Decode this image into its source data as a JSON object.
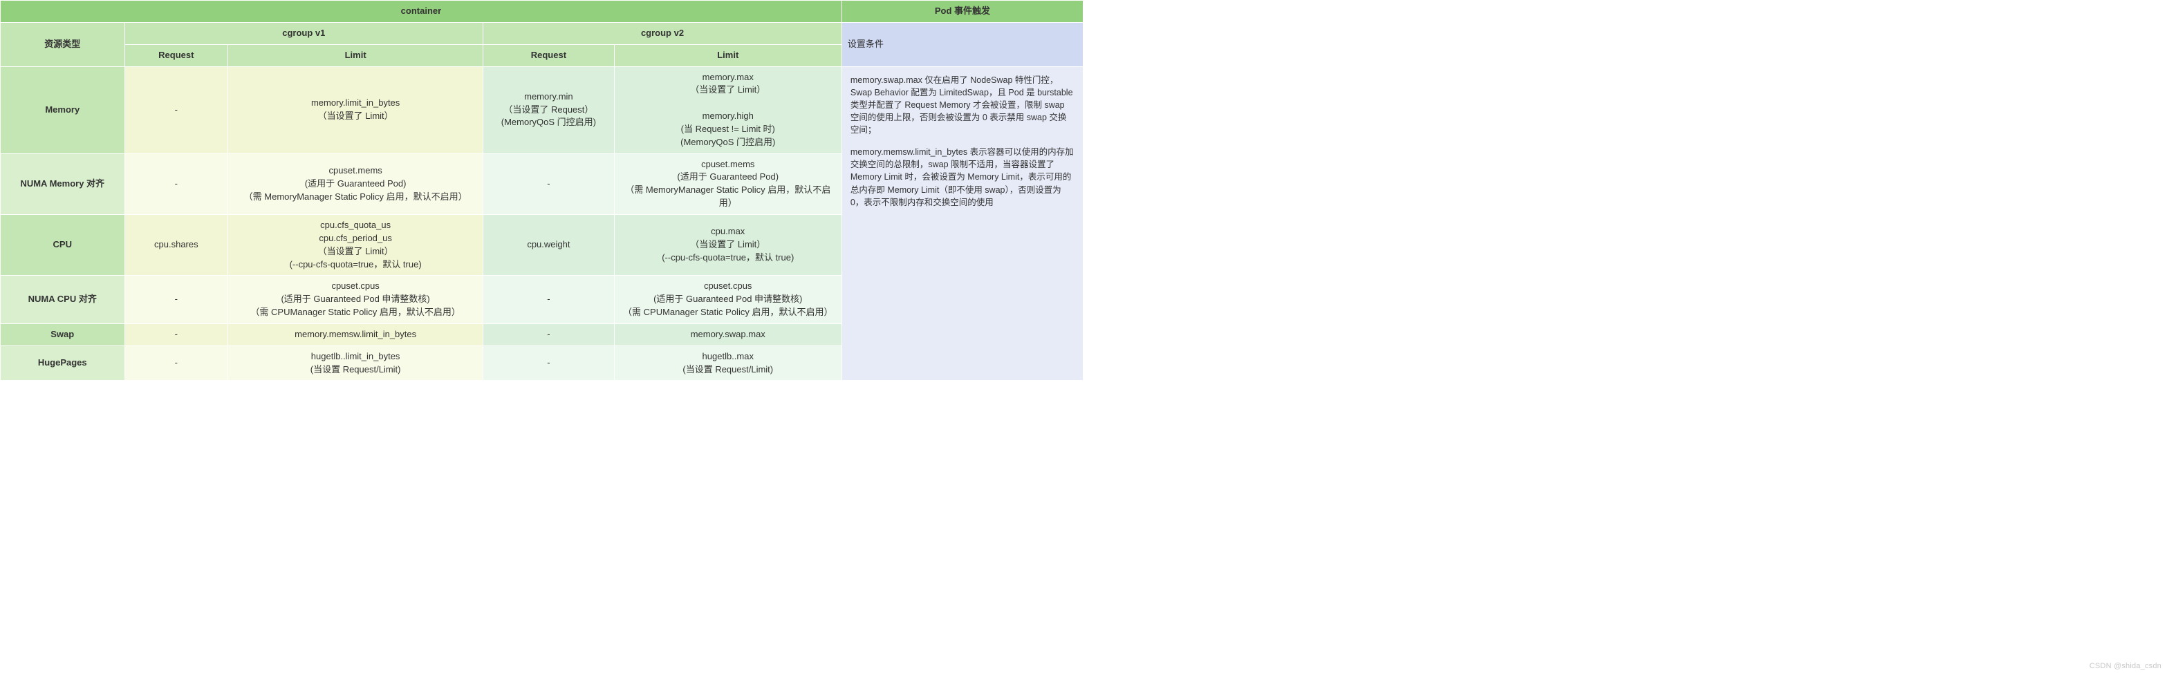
{
  "columns": {
    "rowhdr": 90,
    "v1req": 75,
    "v1lim": 185,
    "v2req": 95,
    "v2lim": 165,
    "pod": 175
  },
  "headers": {
    "container": "container",
    "pod_trigger": "Pod 事件触发",
    "resource_type": "资源类型",
    "cgroup_v1": "cgroup v1",
    "cgroup_v2": "cgroup v2",
    "request": "Request",
    "limit": "Limit",
    "set_condition": "设置条件"
  },
  "rows": [
    {
      "label": "Memory",
      "v1_req": "-",
      "v1_lim": "memory.limit_in_bytes\n（当设置了 Limit）",
      "v2_req": "memory.min\n（当设置了 Request）\n(MemoryQoS 门控启用)",
      "v2_lim": "memory.max\n（当设置了 Limit）\n\nmemory.high\n(当 Request != Limit 时)\n(MemoryQoS 门控启用)"
    },
    {
      "label": "NUMA Memory 对齐",
      "v1_req": "-",
      "v1_lim": "cpuset.mems\n(适用于 Guaranteed Pod)\n（需 MemoryManager Static Policy 启用，默认不启用）",
      "v2_req": "-",
      "v2_lim": "cpuset.mems\n(适用于 Guaranteed Pod)\n（需 MemoryManager Static Policy 启用，默认不启用）"
    },
    {
      "label": "CPU",
      "v1_req": "cpu.shares",
      "v1_lim": "cpu.cfs_quota_us\ncpu.cfs_period_us\n（当设置了 Limit）\n(--cpu-cfs-quota=true，默认 true)",
      "v2_req": "cpu.weight",
      "v2_lim": "cpu.max\n（当设置了 Limit）\n(--cpu-cfs-quota=true，默认 true)"
    },
    {
      "label": "NUMA CPU 对齐",
      "v1_req": "-",
      "v1_lim": "cpuset.cpus\n(适用于 Guaranteed Pod 申请整数核)\n（需 CPUManager Static Policy 启用，默认不启用）",
      "v2_req": "-",
      "v2_lim": "cpuset.cpus\n(适用于 Guaranteed Pod 申请整数核)\n（需 CPUManager Static Policy 启用，默认不启用）"
    },
    {
      "label": "Swap",
      "v1_req": "-",
      "v1_lim": "memory.memsw.limit_in_bytes",
      "v2_req": "-",
      "v2_lim": "memory.swap.max"
    },
    {
      "label": "HugePages",
      "v1_req": "-",
      "v1_lim": "hugetlb.<size>.limit_in_bytes\n(当设置 Request/Limit)",
      "v2_req": "-",
      "v2_lim": "hugetlb.<size>.max\n(当设置 Request/Limit)"
    }
  ],
  "pod_body": {
    "p1": "memory.swap.max 仅在启用了 NodeSwap 特性门控，Swap Behavior 配置为 LimitedSwap，且 Pod 是 burstable 类型并配置了 Request Memory 才会被设置，限制 swap 空间的使用上限，否则会被设置为 0 表示禁用 swap 交换空间；",
    "p2": "memory.memsw.limit_in_bytes 表示容器可以使用的内存加交换空间的总限制，swap 限制不适用，当容器设置了 Memory Limit 时，会被设置为 Memory Limit，表示可用的总内存即 Memory Limit（即不使用 swap），否则设置为 0，表示不限制内存和交换空间的使用"
  },
  "watermark": "CSDN @shida_csdn"
}
